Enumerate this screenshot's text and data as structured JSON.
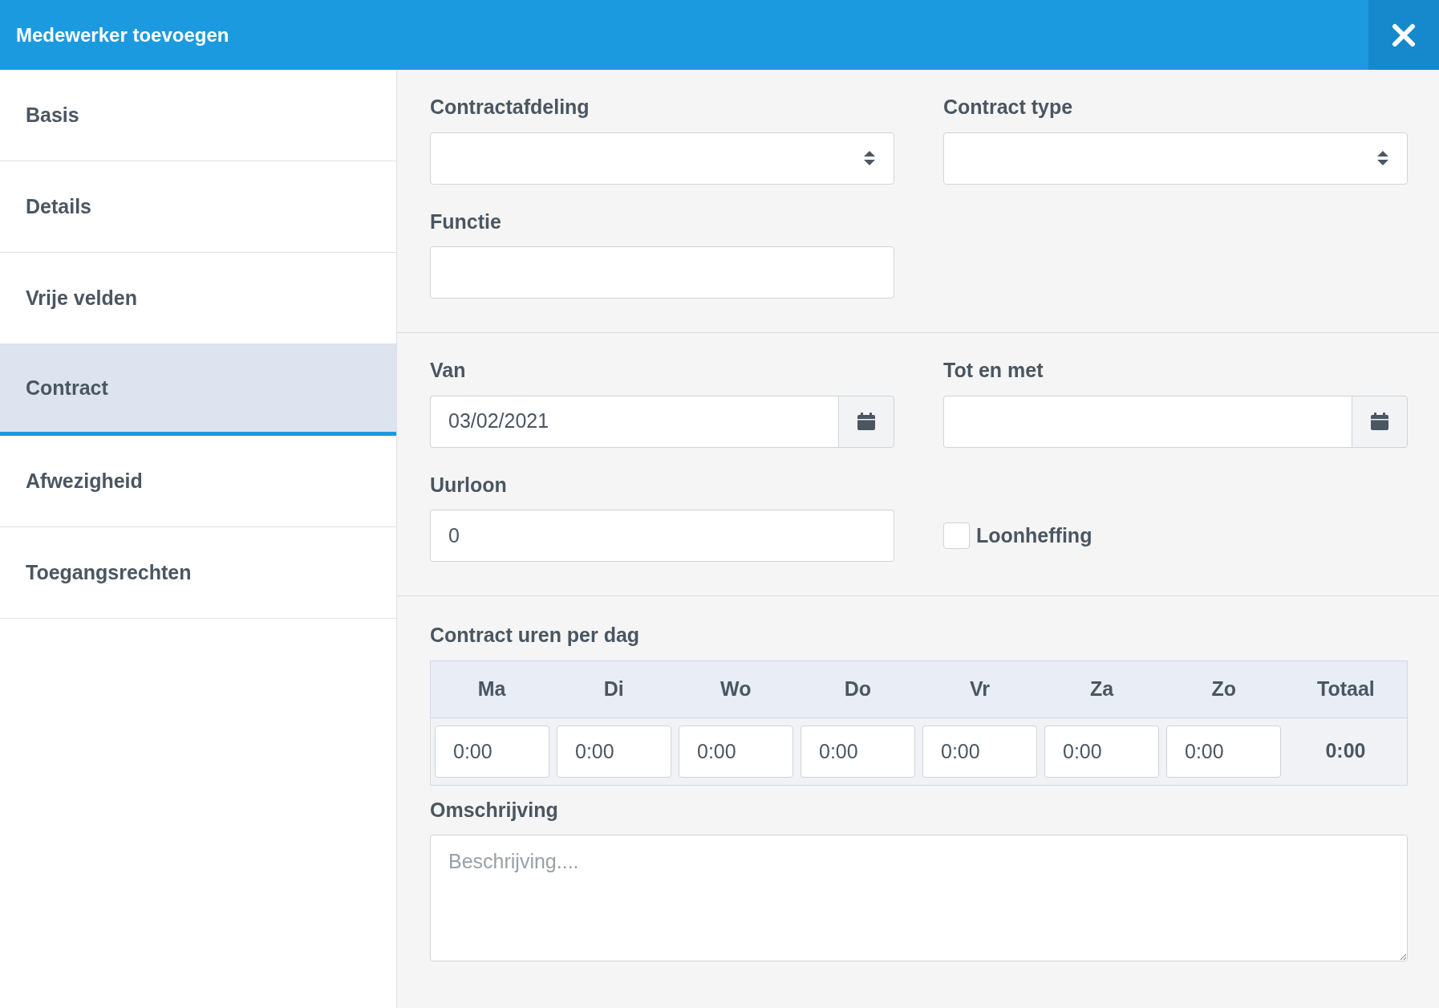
{
  "header": {
    "title": "Medewerker toevoegen"
  },
  "sidebar": {
    "items": [
      {
        "label": "Basis",
        "selected": false
      },
      {
        "label": "Details",
        "selected": false
      },
      {
        "label": "Vrije velden",
        "selected": false
      },
      {
        "label": "Contract",
        "selected": true
      },
      {
        "label": "Afwezigheid",
        "selected": false
      },
      {
        "label": "Toegangsrechten",
        "selected": false
      }
    ]
  },
  "sections": [
    {
      "fields": [
        {
          "kind": "select",
          "label": "Contractafdeling"
        },
        {
          "kind": "select",
          "label": "Contract type"
        },
        {
          "kind": "text",
          "label": "Functie"
        }
      ]
    },
    {
      "fields": [
        {
          "kind": "date",
          "label": "Van",
          "value": "03/02/2021"
        },
        {
          "kind": "date",
          "label": "Tot en met"
        },
        {
          "kind": "text",
          "label": "Uurloon",
          "value": "0"
        },
        {
          "kind": "checkbox",
          "label": "Loonheffing",
          "checked": false
        }
      ]
    }
  ],
  "hours": {
    "title": "Contract uren per dag",
    "days": [
      {
        "day": "Ma",
        "value": "0:00"
      },
      {
        "day": "Di",
        "value": "0:00"
      },
      {
        "day": "Wo",
        "value": "0:00"
      },
      {
        "day": "Do",
        "value": "0:00"
      },
      {
        "day": "Vr",
        "value": "0:00"
      },
      {
        "day": "Za",
        "value": "0:00"
      },
      {
        "day": "Zo",
        "value": "0:00"
      }
    ],
    "total_label": "Totaal",
    "total": "0:00"
  },
  "description": {
    "label": "Omschrijving",
    "placeholder": "Beschrijving...."
  }
}
